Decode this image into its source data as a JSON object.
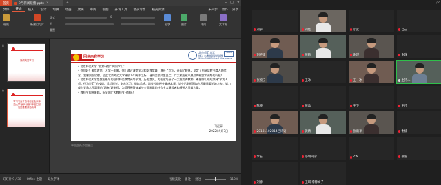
{
  "app": {
    "home_tab": "首页",
    "doc_tab": "9月新闻联播.pptx",
    "menus": [
      "文件",
      "开始",
      "插入",
      "设计",
      "切换",
      "动画",
      "放映",
      "审阅",
      "视图",
      "开发工具",
      "会员专享",
      "稻壳资源"
    ],
    "active_menu": "开始",
    "right_tools": [
      "未同步",
      "协作",
      "分享"
    ],
    "ribbon": {
      "paste": "粘贴",
      "new_slide": "新建幻灯片",
      "layout": "版式",
      "section": "节",
      "reset": "重置",
      "font_size": "0",
      "shape": "形状",
      "picture": "图片",
      "arrange": "排列",
      "textbox": "文本框"
    },
    "thumbnails": [
      {
        "number": "8",
        "caption": "新闻内容学习",
        "selected": false
      },
      {
        "number": "9",
        "caption": "学习习近平总书记在北京师范大学\"优师计划\"师范生回信的重要讲话精神",
        "selected": true
      }
    ],
    "slide": {
      "title": "回信内容学习",
      "logo_cn": "北京师范大学\n统计与数据科学学院",
      "logo_en": "School of Statistics and Data Science",
      "logo_box": "SDSS",
      "body": [
        "• 北京师范大学 \"优师计划\" 的同学们：",
        "• 你们好！来信收悉。入学一年来，你们通过课堂学习和支教实践，增长了学识，开阔了眼界，坚定了到基层教书育人的信念，我感到很欣慰。值此北京师范大学建校120周年之际，谨向全校师生员工、广大校友致以热烈的祝贺和诚挚的问候！",
        "• 北京师范大学是我国最早的现代师范教育高等学府，历史悠久，为国家培养了一大批优秀教师。希望你们继续秉持\"学为人师，行为世范\"的校训，珍惜时光，刻苦学习，锻炼品格，增长传道授业解惑本领，毕业后到祖国和人民最需要的地方去，努力成为党和人民满意的\"四有\"好老师，为培养德智体美劳全面发展的社会主义建设者和接班人贡献力量。",
        "• 教师节即将来临，祝全国广大教师节日快乐！"
      ],
      "signature": "习近平",
      "date": "2022年9月7日"
    },
    "notes_placeholder": "单击此处添加备注",
    "status": {
      "slide_indicator": "幻灯片 9 / 38",
      "theme": "Office 主题",
      "missing_font": "缺失字体",
      "smart_beautify": "智能美化",
      "notes": "备注",
      "comments": "批注",
      "zoom": "110%"
    }
  },
  "meeting": {
    "page_indicator": "1/2",
    "tiles": [
      {
        "name": "刘宇",
        "video": false,
        "mic_on": false
      },
      {
        "name": "刘佳",
        "video": true,
        "mic_on": false
      },
      {
        "name": "小武",
        "video": false,
        "mic_on": false
      },
      {
        "name": "自己",
        "video": false,
        "mic_on": false
      },
      {
        "name": "刘子潇",
        "video": true,
        "mic_on": false
      },
      {
        "name": "张鹏",
        "video": true,
        "mic_on": false
      },
      {
        "name": "谢瑾",
        "video": true,
        "mic_on": false
      },
      {
        "name": "谢瑾",
        "video": false,
        "mic_on": false
      },
      {
        "name": "张婉宁",
        "video": true,
        "mic_on": false
      },
      {
        "name": "王冰",
        "video": false,
        "mic_on": false
      },
      {
        "name": "王一冰",
        "video": true,
        "mic_on": false
      },
      {
        "name": "主持人",
        "video": true,
        "mic_on": true
      },
      {
        "name": "陈晓",
        "video": false,
        "mic_on": false
      },
      {
        "name": "张晶",
        "video": false,
        "mic_on": false
      },
      {
        "name": "王卫",
        "video": false,
        "mic_on": false
      },
      {
        "name": "王佳",
        "video": false,
        "mic_on": false
      },
      {
        "name": "20181102014吕诗语",
        "video": true,
        "mic_on": false
      },
      {
        "name": "黄婧",
        "video": true,
        "mic_on": false
      },
      {
        "name": "张雨亭",
        "video": true,
        "mic_on": false
      },
      {
        "name": "谢楠",
        "video": false,
        "mic_on": false
      },
      {
        "name": "李志",
        "video": false,
        "mic_on": false
      },
      {
        "name": "小明同学",
        "video": false,
        "mic_on": false
      },
      {
        "name": "ZW",
        "video": false,
        "mic_on": false
      },
      {
        "name": "张雪",
        "video": false,
        "mic_on": false
      },
      {
        "name": "刘静",
        "video": false,
        "mic_on": false
      },
      {
        "name": "王琪 李静文子",
        "video": false,
        "mic_on": false
      }
    ]
  },
  "colors": {
    "accent": "#d24726",
    "party_red": "#c81e1e",
    "speaking_green": "#2fbf4a"
  }
}
